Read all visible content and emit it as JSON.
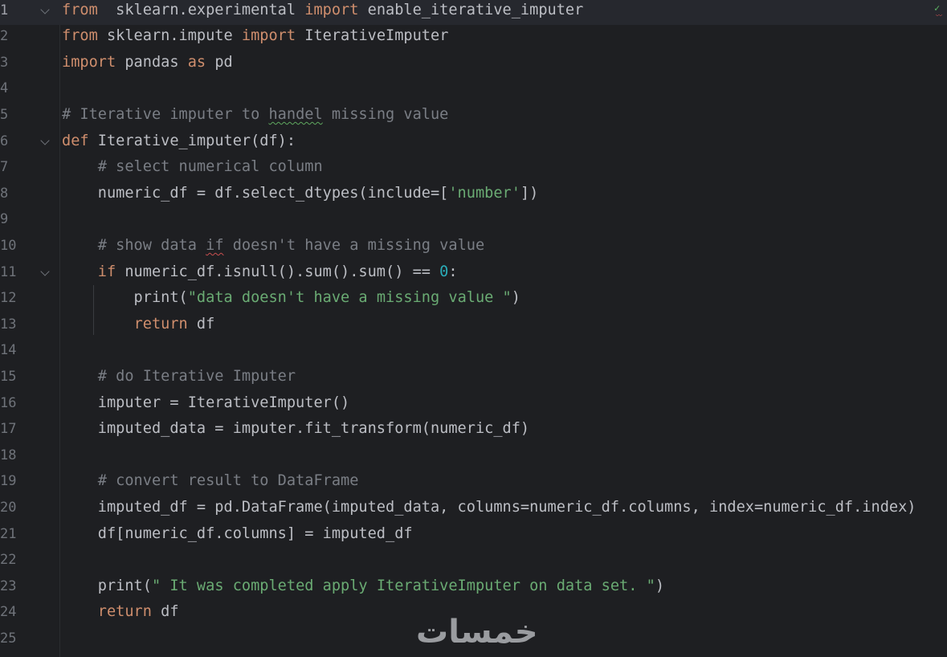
{
  "editor": {
    "language": "python",
    "current_line": 1,
    "inspection_status": "✓"
  },
  "lines": [
    {
      "n": "1",
      "fold": true,
      "tokens": [
        [
          "kw",
          "from"
        ],
        [
          "",
          "  sklearn.experimental "
        ],
        [
          "kw",
          "import"
        ],
        [
          "",
          " enable_iterative_imputer"
        ]
      ]
    },
    {
      "n": "2",
      "fold": false,
      "tokens": [
        [
          "kw",
          "from"
        ],
        [
          "",
          " sklearn.impute "
        ],
        [
          "kw",
          "import"
        ],
        [
          "",
          " IterativeImputer"
        ]
      ]
    },
    {
      "n": "3",
      "fold": false,
      "tokens": [
        [
          "kw",
          "import"
        ],
        [
          "",
          " pandas "
        ],
        [
          "kw",
          "as"
        ],
        [
          "",
          " pd"
        ]
      ]
    },
    {
      "n": "4",
      "fold": false,
      "tokens": []
    },
    {
      "n": "5",
      "fold": false,
      "tokens": [
        [
          "cm",
          "# Iterative imputer to "
        ],
        [
          "cm squiggle-g",
          "handel"
        ],
        [
          "cm",
          " missing value"
        ]
      ]
    },
    {
      "n": "6",
      "fold": true,
      "tokens": [
        [
          "kw",
          "def"
        ],
        [
          "",
          " Iterative_imputer(df):"
        ]
      ]
    },
    {
      "n": "7",
      "fold": false,
      "tokens": [
        [
          "",
          "    "
        ],
        [
          "cm",
          "# select numerical column"
        ]
      ]
    },
    {
      "n": "8",
      "fold": false,
      "tokens": [
        [
          "",
          "    numeric_df = df.select_dtypes(include=["
        ],
        [
          "str",
          "'number'"
        ],
        [
          "",
          "])"
        ]
      ]
    },
    {
      "n": "9",
      "fold": false,
      "tokens": []
    },
    {
      "n": "10",
      "fold": false,
      "tokens": [
        [
          "",
          "    "
        ],
        [
          "cm",
          "# show data "
        ],
        [
          "cm squiggle-r",
          "if"
        ],
        [
          "cm",
          " doesn't have a missing value"
        ]
      ]
    },
    {
      "n": "11",
      "fold": true,
      "tokens": [
        [
          "",
          "    "
        ],
        [
          "kw",
          "if"
        ],
        [
          "",
          " numeric_df.isnull().sum().sum() == "
        ],
        [
          "num",
          "0"
        ],
        [
          "",
          ":"
        ]
      ]
    },
    {
      "n": "12",
      "fold": false,
      "tokens": [
        [
          "",
          "        print("
        ],
        [
          "str",
          "\"data doesn't have a missing value \""
        ],
        [
          "",
          ")"
        ]
      ]
    },
    {
      "n": "13",
      "fold": false,
      "tokens": [
        [
          "",
          "        "
        ],
        [
          "kw",
          "return"
        ],
        [
          "",
          " df"
        ]
      ]
    },
    {
      "n": "14",
      "fold": false,
      "tokens": []
    },
    {
      "n": "15",
      "fold": false,
      "tokens": [
        [
          "",
          "    "
        ],
        [
          "cm",
          "# do Iterative Imputer"
        ]
      ]
    },
    {
      "n": "16",
      "fold": false,
      "tokens": [
        [
          "",
          "    imputer = IterativeImputer()"
        ]
      ]
    },
    {
      "n": "17",
      "fold": false,
      "tokens": [
        [
          "",
          "    imputed_data = imputer.fit_transform(numeric_df)"
        ]
      ]
    },
    {
      "n": "18",
      "fold": false,
      "tokens": []
    },
    {
      "n": "19",
      "fold": false,
      "tokens": [
        [
          "",
          "    "
        ],
        [
          "cm",
          "# convert result to DataFrame"
        ]
      ]
    },
    {
      "n": "20",
      "fold": false,
      "tokens": [
        [
          "",
          "    imputed_df = pd.DataFrame(imputed_data, columns=numeric_df.columns, index=numeric_df.index)"
        ]
      ]
    },
    {
      "n": "21",
      "fold": false,
      "tokens": [
        [
          "",
          "    df[numeric_df.columns] = imputed_df"
        ]
      ]
    },
    {
      "n": "22",
      "fold": false,
      "tokens": []
    },
    {
      "n": "23",
      "fold": false,
      "tokens": [
        [
          "",
          "    print("
        ],
        [
          "str",
          "\" It was completed apply IterativeImputer on data set. \""
        ],
        [
          "",
          ")"
        ]
      ]
    },
    {
      "n": "24",
      "fold": false,
      "tokens": [
        [
          "",
          "    "
        ],
        [
          "kw",
          "return"
        ],
        [
          "",
          " df"
        ]
      ]
    },
    {
      "n": "25",
      "fold": false,
      "tokens": []
    }
  ],
  "watermark": {
    "text": "خمسات"
  }
}
